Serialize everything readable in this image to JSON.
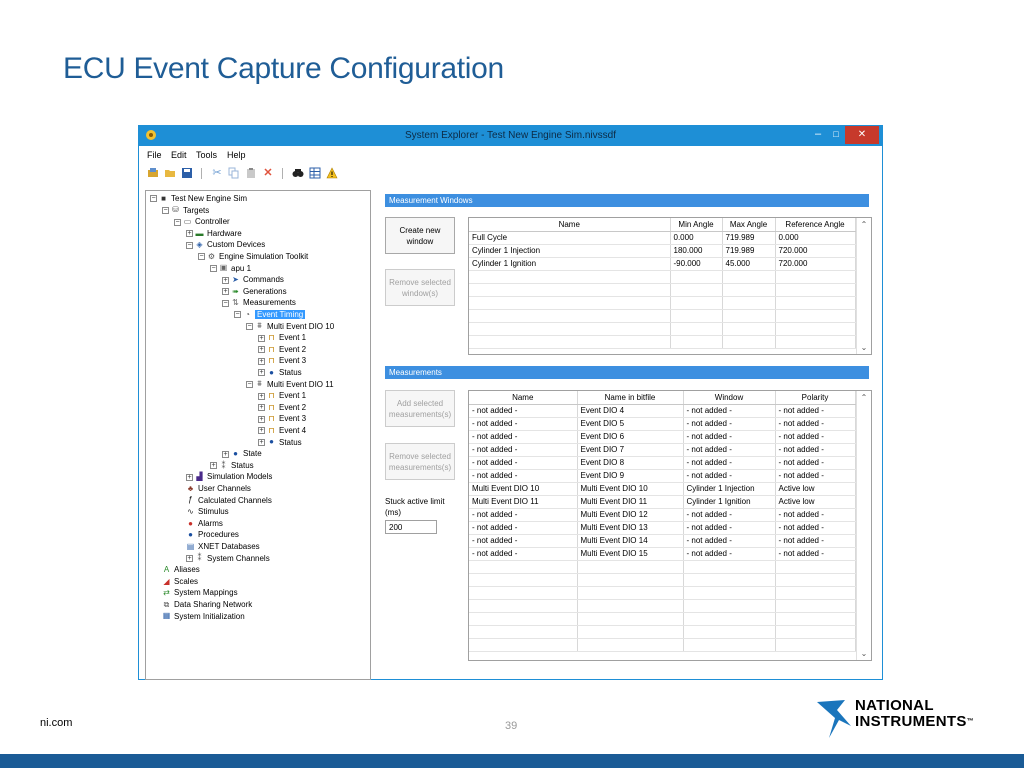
{
  "slide": {
    "title": "ECU Event Capture Configuration",
    "footer_url": "ni.com",
    "page_number": "39",
    "logo_line1": "NATIONAL",
    "logo_line2": "INSTRUMENTS",
    "logo_tm": "™",
    "bar_color": "#1a5b96"
  },
  "window": {
    "title": "System Explorer - Test New Engine Sim.nivssdf",
    "minimize_glyph": "‒",
    "maximize_glyph": "□",
    "close_glyph": "✕"
  },
  "menu": [
    "File",
    "Edit",
    "Tools",
    "Help"
  ],
  "toolbar_icons": [
    "new-project-icon",
    "open-folder-icon",
    "save-icon",
    "cut-icon",
    "copy-icon",
    "paste-icon",
    "delete-icon",
    "find-icon",
    "grid-view-icon",
    "warning-icon"
  ],
  "tree": [
    {
      "label": "Test New Engine Sim",
      "icon": "computer-icon",
      "exp": "⊟"
    },
    {
      "label": "Targets",
      "icon": "targets-icon",
      "exp": "⊟"
    },
    {
      "label": "Controller",
      "icon": "controller-icon",
      "exp": "⊟"
    },
    {
      "label": "Hardware",
      "icon": "hardware-icon",
      "exp": "⊞"
    },
    {
      "label": "Custom Devices",
      "icon": "custom-devices-icon",
      "exp": "⊟"
    },
    {
      "label": "Engine Simulation Toolkit",
      "icon": "toolkit-icon",
      "exp": "⊟"
    },
    {
      "label": "apu 1",
      "icon": "apu-icon",
      "exp": "⊟"
    },
    {
      "label": "Commands",
      "icon": "commands-icon",
      "exp": "⊞"
    },
    {
      "label": "Generations",
      "icon": "generations-icon",
      "exp": "⊞"
    },
    {
      "label": "Measurements",
      "icon": "measurements-icon",
      "exp": "⊟"
    },
    {
      "label": "Event Timing",
      "icon": "event-timing-icon",
      "exp": "⊟",
      "selected": true
    },
    {
      "label": "Multi Event DIO 10",
      "icon": "multi-event-icon",
      "exp": "⊟"
    },
    {
      "label": "Event 1",
      "icon": "event-icon",
      "exp": "⊞"
    },
    {
      "label": "Event 2",
      "icon": "event-icon",
      "exp": "⊞"
    },
    {
      "label": "Event 3",
      "icon": "event-icon",
      "exp": "⊞"
    },
    {
      "label": "Status",
      "icon": "info-icon",
      "exp": "⊞"
    },
    {
      "label": "Multi Event DIO 11",
      "icon": "multi-event-icon",
      "exp": "⊟"
    },
    {
      "label": "Event 1",
      "icon": "event-icon",
      "exp": "⊞"
    },
    {
      "label": "Event 2",
      "icon": "event-icon",
      "exp": "⊞"
    },
    {
      "label": "Event 3",
      "icon": "event-icon",
      "exp": "⊞"
    },
    {
      "label": "Event 4",
      "icon": "event-icon",
      "exp": "⊞"
    },
    {
      "label": "Status",
      "icon": "info-icon",
      "exp": "⊞"
    },
    {
      "label": "State",
      "icon": "info-icon",
      "exp": "⊞"
    },
    {
      "label": "Status",
      "icon": "status-icon",
      "exp": "⊞"
    },
    {
      "label": "Simulation Models",
      "icon": "simulation-models-icon",
      "exp": "⊞"
    },
    {
      "label": "User Channels",
      "icon": "user-channels-icon",
      "exp": ""
    },
    {
      "label": "Calculated Channels",
      "icon": "calculated-channels-icon",
      "exp": ""
    },
    {
      "label": "Stimulus",
      "icon": "stimulus-icon",
      "exp": ""
    },
    {
      "label": "Alarms",
      "icon": "alarms-icon",
      "exp": ""
    },
    {
      "label": "Procedures",
      "icon": "procedures-icon",
      "exp": ""
    },
    {
      "label": "XNET Databases",
      "icon": "xnet-icon",
      "exp": ""
    },
    {
      "label": "System Channels",
      "icon": "system-channels-icon",
      "exp": "⊞"
    },
    {
      "label": "Aliases",
      "icon": "aliases-icon",
      "exp": ""
    },
    {
      "label": "Scales",
      "icon": "scales-icon",
      "exp": ""
    },
    {
      "label": "System Mappings",
      "icon": "mappings-icon",
      "exp": ""
    },
    {
      "label": "Data Sharing Network",
      "icon": "network-icon",
      "exp": ""
    },
    {
      "label": "System Initialization",
      "icon": "init-icon",
      "exp": ""
    }
  ],
  "measurement_windows": {
    "header": "Measurement Windows",
    "create_button": "Create new window",
    "remove_button": "Remove selected window(s)",
    "columns": [
      "Name",
      "Min Angle",
      "Max Angle",
      "Reference Angle"
    ],
    "rows": [
      [
        "Full Cycle",
        "0.000",
        "719.989",
        "0.000"
      ],
      [
        "Cylinder 1 Injection",
        "180.000",
        "719.989",
        "720.000"
      ],
      [
        "Cylinder 1 Ignition",
        "-90.000",
        "45.000",
        "720.000"
      ]
    ]
  },
  "measurements": {
    "header": "Measurements",
    "add_button": "Add selected measurements(s)",
    "remove_button": "Remove selected measurements(s)",
    "stuck_label": "Stuck active limit (ms)",
    "stuck_value": "200",
    "columns": [
      "Name",
      "Name in bitfile",
      "Window",
      "Polarity"
    ],
    "rows": [
      [
        "- not added -",
        "Event DIO 4",
        "- not added -",
        "- not added -"
      ],
      [
        "- not added -",
        "Event DIO 5",
        "- not added -",
        "- not added -"
      ],
      [
        "- not added -",
        "Event DIO 6",
        "- not added -",
        "- not added -"
      ],
      [
        "- not added -",
        "Event DIO 7",
        "- not added -",
        "- not added -"
      ],
      [
        "- not added -",
        "Event DIO 8",
        "- not added -",
        "- not added -"
      ],
      [
        "- not added -",
        "Event DIO 9",
        "- not added -",
        "- not added -"
      ],
      [
        "Multi Event DIO 10",
        "Multi Event DIO 10",
        "Cylinder 1 Injection",
        "Active low"
      ],
      [
        "Multi Event DIO 11",
        "Multi Event DIO 11",
        "Cylinder 1 Ignition",
        "Active low"
      ],
      [
        "- not added -",
        "Multi Event DIO 12",
        "- not added -",
        "- not added -"
      ],
      [
        "- not added -",
        "Multi Event DIO 13",
        "- not added -",
        "- not added -"
      ],
      [
        "- not added -",
        "Multi Event DIO 14",
        "- not added -",
        "- not added -"
      ],
      [
        "- not added -",
        "Multi Event DIO 15",
        "- not added -",
        "- not added -"
      ]
    ]
  }
}
